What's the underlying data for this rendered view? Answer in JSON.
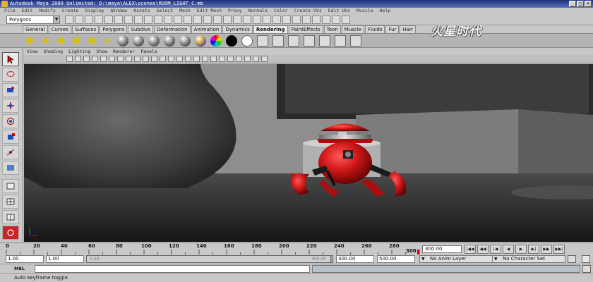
{
  "window": {
    "title": "Autodesk Maya 2009 Unlimited: D:\\maya\\ALEX\\scenes\\ROOM_LIGHT_C.mb"
  },
  "menus": [
    "File",
    "Edit",
    "Modify",
    "Create",
    "Display",
    "Window",
    "Assets",
    "Select",
    "Mesh",
    "Edit Mesh",
    "Proxy",
    "Normals",
    "Color",
    "Create UVs",
    "Edit UVs",
    "Muscle",
    "Help"
  ],
  "status_line": {
    "mode": "Polygons"
  },
  "shelf": {
    "tabs": [
      "General",
      "Curves",
      "Surfaces",
      "Polygons",
      "Subdivs",
      "Deformation",
      "Animation",
      "Dynamics",
      "Rendering",
      "PaintEffects",
      "Toon",
      "Muscle",
      "Fluids",
      "Fur",
      "Hair"
    ],
    "active_tab": "Rendering"
  },
  "panel_menu": [
    "View",
    "Shading",
    "Lighting",
    "Show",
    "Renderer",
    "Panels"
  ],
  "watermark": "火星时代",
  "time_slider": {
    "ticks": [
      "0",
      "20",
      "40",
      "60",
      "80",
      "100",
      "120",
      "140",
      "160",
      "180",
      "200",
      "220",
      "240",
      "260",
      "280",
      "300"
    ],
    "current_frame": "300.00"
  },
  "range_slider": {
    "start": "1.00",
    "playback_start": "1.00",
    "range_start_label": "1.00",
    "range_end_label": "300.00",
    "playback_end": "300.00",
    "end": "500.00",
    "anim_layer": "No Anim Layer",
    "character_set": "No Character Set"
  },
  "command_line": {
    "label": "MEL"
  },
  "help_line": {
    "text": "Auto keyframe toggle"
  },
  "colors": {
    "robot_red": "#d01818",
    "title_bar": "#2a3c8a",
    "viewport_bg": "#8f8f8f"
  }
}
